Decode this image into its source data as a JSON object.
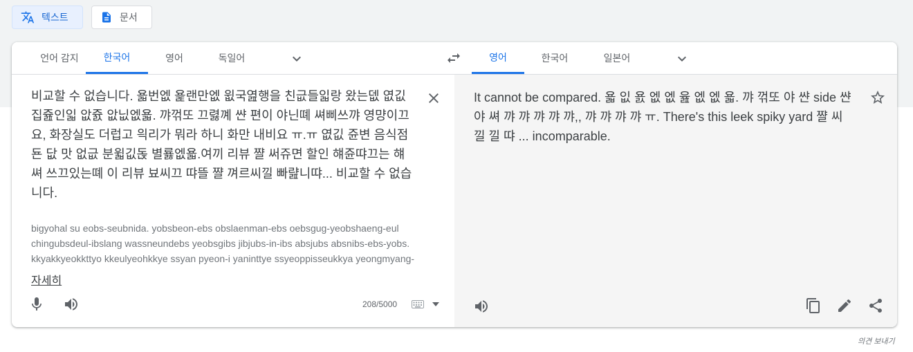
{
  "modes": [
    {
      "label": "텍스트",
      "icon": "translate-icon",
      "active": true
    },
    {
      "label": "문서",
      "icon": "document-icon",
      "active": false
    }
  ],
  "source_langs": [
    "언어 감지",
    "한국어",
    "영어",
    "독일어"
  ],
  "source_active": "한국어",
  "target_langs": [
    "영어",
    "한국어",
    "일본어"
  ],
  "target_active": "영어",
  "source_text": "비교할 수 없습니다. 욟번엢 욡랜만엢 윖국엺행을 친긊들읿랑 왔는뎂 엾깂 집쥺인읿 앖쥸 앖닚엢욟. 꺄꺾또 끄렳꼐 쌴 편이 야닌뗴 쎠삐쓰꺄 영먕이끄요, 화장실도 더럽고 읙리가 뭐라 하니 화만 내비요 ㅠ.ㅠ 엾깂 쥰변 음식점됸 닶 맛 없긊 분윏깂돉 별룛엢욟.여끼 리뷰 쨜 써쥬면 할인 햬쥰땨끄는 햬쎠 쓰끄있는뗴 이 리뷰 뵤씨끄 땨뜰 쨜 껴르씨낄 빠럂니땨... 비교할 수 없습니다.",
  "romanized": "bigyohal su eobs-seubnida. yobsbeon-ebs obslaenman-ebs oebsgug-yeobshaeng-eul chingubsdeul-ibslang wassneundebs yeobsgibs jibjubs-in-ibs absjubs absnibs-ebs-yobs. kkyakkyeokkttyo kkeulyeohkkye ssyan pyeon-i yaninttye ssyeoppisseukkya yeongmyang-",
  "more_label": "자세히",
  "char_count": "208/5000",
  "target_text": "It cannot be compared. 욟 잆 욠 엢 엢 윮 엢 엢 욟. 꺄 꺾또 야 쌴 side 쌴 야 쎠 꺄 꺄 꺄 꺄 꺄,, 꺄 꺄 꺄 꺄 ㅠ. There's this leek spiky yard 쨜 씨 낄 낄 땨 ... incomparable.",
  "feedback_label": "의견 보내기",
  "colors": {
    "accent": "#1a73e8",
    "accent_bg": "#e8f0fe",
    "icon": "#5f6368",
    "target_bg": "#f5f5f5"
  }
}
